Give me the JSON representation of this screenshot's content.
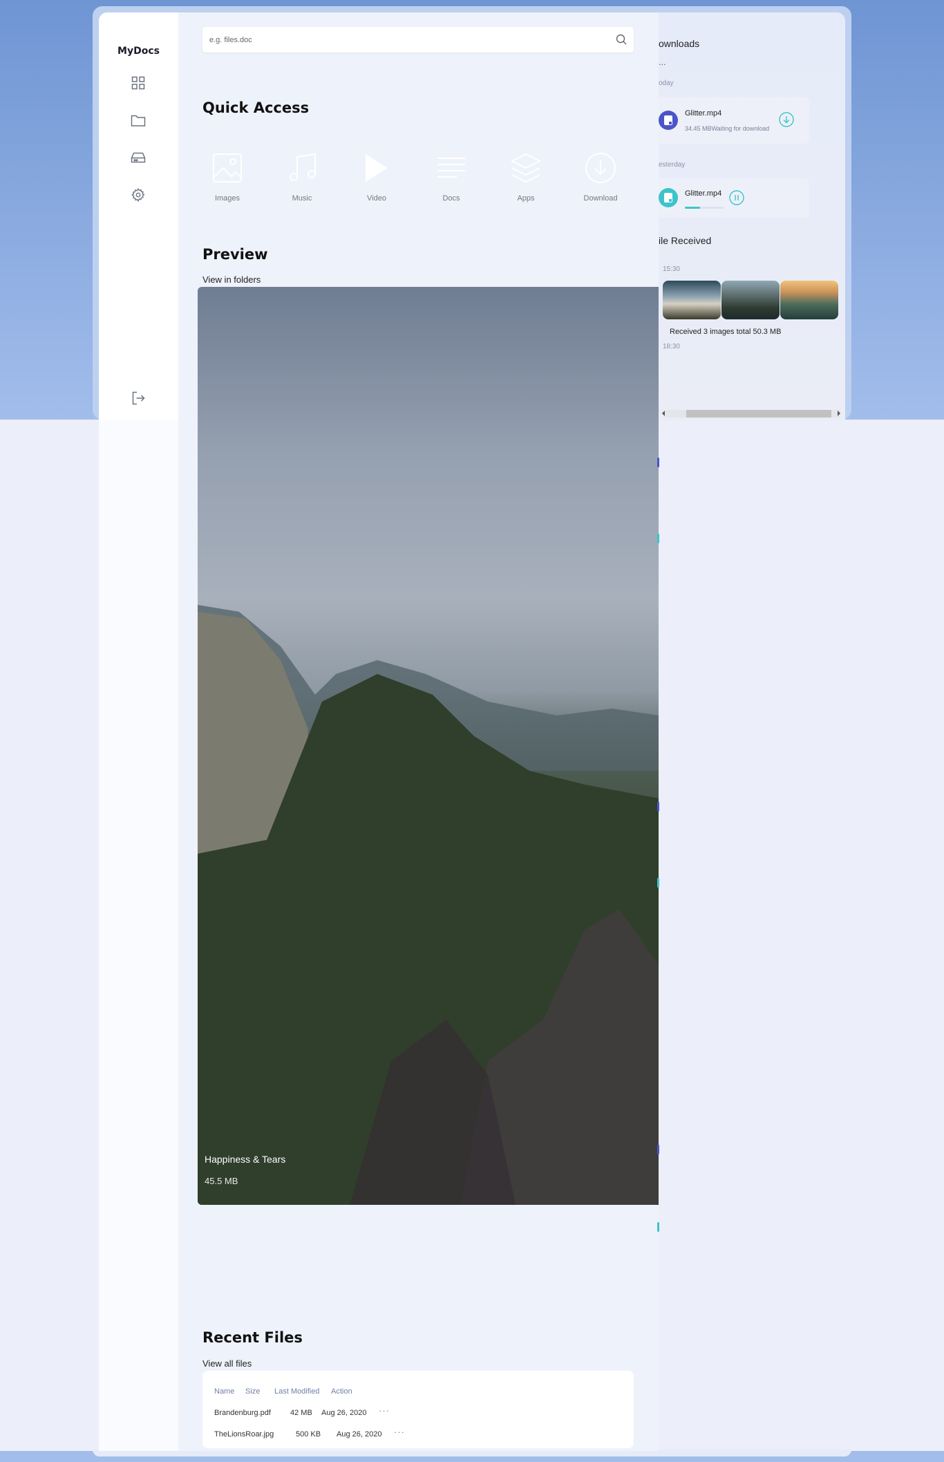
{
  "app": {
    "name": "MyDocs"
  },
  "sidebar": {
    "icons": [
      "grid-icon",
      "folder-icon",
      "drive-icon",
      "gear-icon"
    ],
    "logout_icon": "logout-icon"
  },
  "search": {
    "placeholder": "e.g. files.doc",
    "icon": "search-icon"
  },
  "quick_access": {
    "title": "Quick Access",
    "items": [
      {
        "label": "Images",
        "icon": "image-icon"
      },
      {
        "label": "Music",
        "icon": "music-icon"
      },
      {
        "label": "Video",
        "icon": "play-icon"
      },
      {
        "label": "Docs",
        "icon": "docs-icon"
      },
      {
        "label": "Apps",
        "icon": "layers-icon"
      },
      {
        "label": "Download",
        "icon": "download-icon"
      }
    ]
  },
  "preview": {
    "title": "Preview",
    "link": "View in folders",
    "card_title": "Happiness & Tears",
    "card_size": "45.5 MB"
  },
  "recent_files": {
    "title": "Recent Files",
    "link": "View all files",
    "columns": [
      "Name",
      "Size",
      "Last Modified",
      "Action"
    ],
    "rows": [
      {
        "name": "Brandenburg.pdf",
        "size": "42 MB",
        "modified": "Aug 26, 2020",
        "action": "···"
      },
      {
        "name": "TheLionsRoar.jpg",
        "size": "500 KB",
        "modified": "Aug 26, 2020",
        "action": "···"
      }
    ]
  },
  "downloads": {
    "title": "ownloads",
    "subtitle": "...",
    "groups": [
      {
        "date": "oday",
        "file": "Glitter.mp4",
        "meta": "34.45 MBWaiting for download",
        "action_icon": "download-circle-icon"
      },
      {
        "date": "esterday",
        "file": "Glitter.mp4",
        "progress": 0.4,
        "action_icon": "pause-circle-icon"
      }
    ]
  },
  "file_received": {
    "title": "ile Received",
    "time1": "15:30",
    "text": "Received 3 images total 50.3 MB",
    "time2": "18:30"
  },
  "colors": {
    "accent_teal": "#3cc4c9",
    "accent_indigo": "#4b54c9",
    "background_blue": "#7e9ede"
  }
}
